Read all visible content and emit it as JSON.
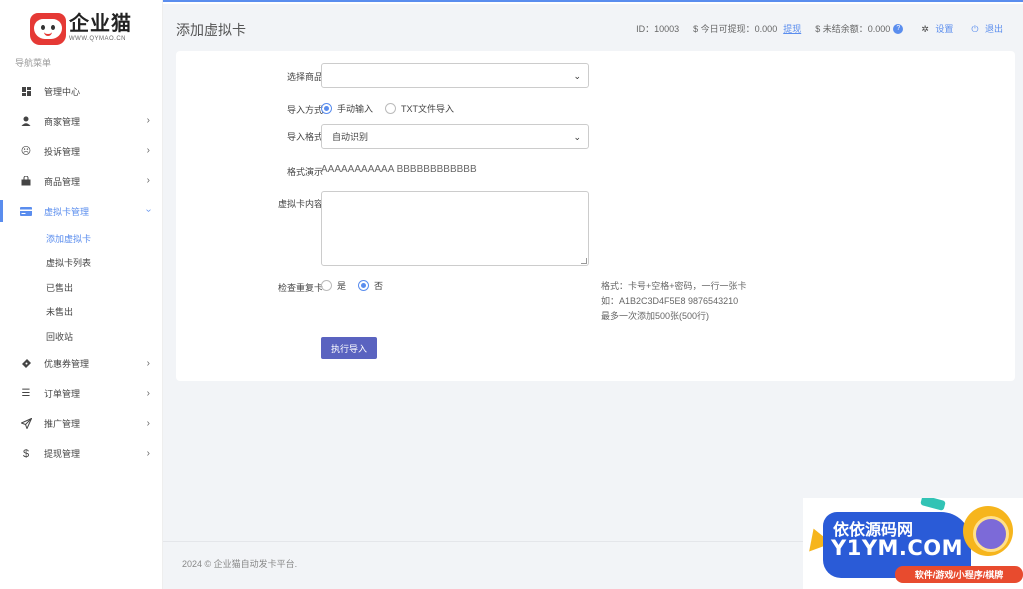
{
  "brand": {
    "title": "企业猫",
    "url": "WWW.QYMAO.CN"
  },
  "sidebar": {
    "caption": "导航菜单",
    "items": [
      {
        "label": "管理中心",
        "icon": "dashboard-icon",
        "has_children": false
      },
      {
        "label": "商家管理",
        "icon": "user-icon",
        "has_children": true
      },
      {
        "label": "投诉管理",
        "icon": "frown-icon",
        "has_children": true
      },
      {
        "label": "商品管理",
        "icon": "shopping-bag-icon",
        "has_children": true
      },
      {
        "label": "虚拟卡管理",
        "icon": "card-icon",
        "has_children": true,
        "active": true,
        "expanded": true
      },
      {
        "label": "优惠券管理",
        "icon": "ticket-icon",
        "has_children": true
      },
      {
        "label": "订单管理",
        "icon": "list-icon",
        "has_children": true
      },
      {
        "label": "推广管理",
        "icon": "send-icon",
        "has_children": true
      },
      {
        "label": "提现管理",
        "icon": "dollar-icon",
        "has_children": true
      }
    ],
    "sub_items": [
      "添加虚拟卡",
      "虚拟卡列表",
      "已售出",
      "未售出",
      "回收站"
    ]
  },
  "header": {
    "page_title": "添加虚拟卡",
    "id_label": "ID：",
    "id_value": "10003",
    "today_label": "$ 今日可提现：",
    "today_value": "0.000",
    "withdraw_link": "提现",
    "unsettled_label": "$ 未结余额：",
    "unsettled_value": "0.000",
    "settings_label": "设置",
    "logout_label": "退出"
  },
  "form": {
    "product_label": "选择商品",
    "product_value": "",
    "import_mode_label": "导入方式",
    "import_mode_options": [
      "手动输入",
      "TXT文件导入"
    ],
    "import_mode_selected": "手动输入",
    "format_label": "导入格式",
    "format_value": "自动识别",
    "demo_label": "格式演示",
    "demo_value": "AAAAAAAAAAA BBBBBBBBBBBB",
    "content_label": "虚拟卡内容",
    "content_value": "",
    "check_dup_label": "检查重复卡",
    "check_dup_options": [
      "是",
      "否"
    ],
    "check_dup_selected": "否",
    "hint_lines": [
      "格式：卡号+空格+密码，一行一张卡",
      "如：A1B2C3D4F5E8 9876543210",
      "最多一次添加500张(500行)"
    ],
    "submit_label": "执行导入"
  },
  "footer": {
    "text": "2024 © 企业猫自动发卡平台."
  },
  "watermark": {
    "cn": "依依源码网",
    "en": "Y1YM.COM",
    "tagline": "软件/游戏/小程序/棋牌"
  },
  "colors": {
    "accent": "#5a8dee",
    "button": "#5a63c0",
    "background": "#f2f4f7"
  }
}
